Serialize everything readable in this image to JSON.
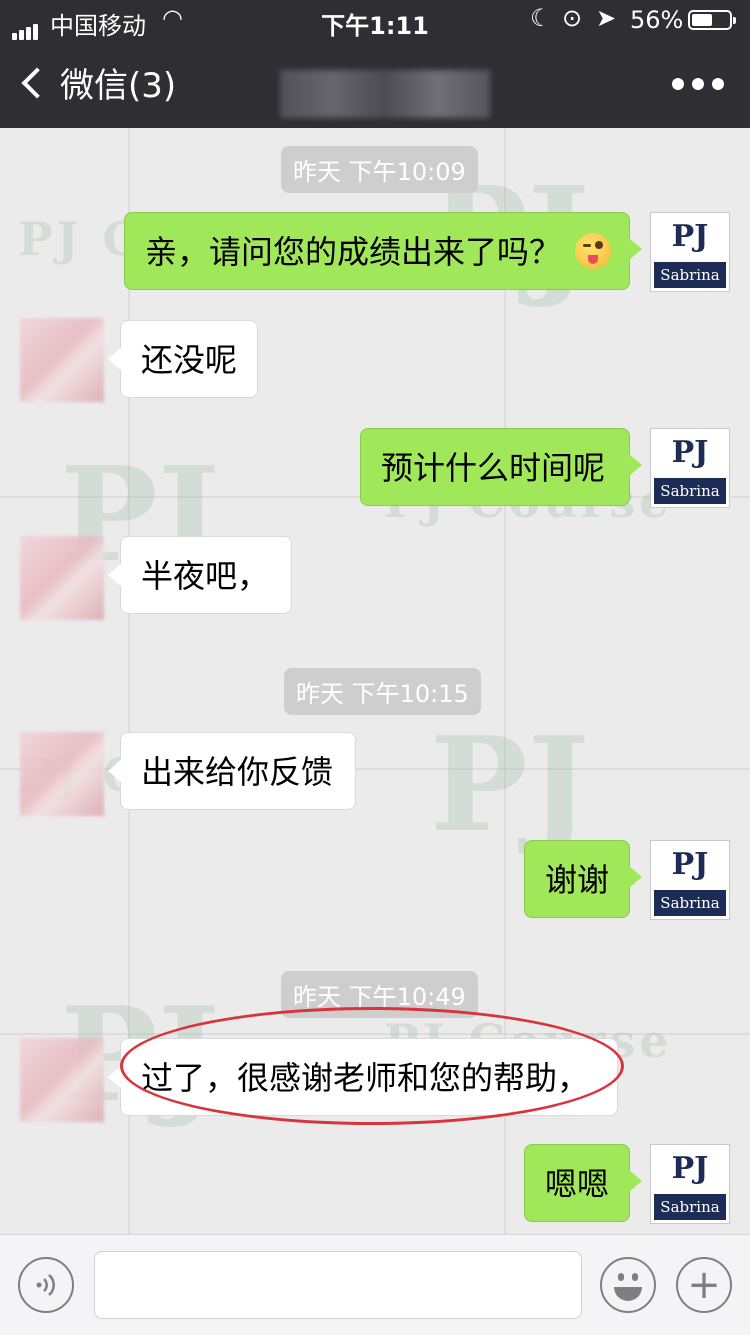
{
  "status_bar": {
    "carrier": "中国移动",
    "time": "下午1:11",
    "battery_percent": "56%",
    "battery_level": 0.56
  },
  "nav": {
    "back_label": "微信(3)"
  },
  "messages": [
    {
      "type": "time",
      "text": "昨天 下午10:09"
    },
    {
      "type": "out",
      "text": "亲，请问您的成绩出来了吗？",
      "emoji": "winking-tongue-emoji"
    },
    {
      "type": "in",
      "text": "还没呢"
    },
    {
      "type": "out",
      "text": "预计什么时间呢"
    },
    {
      "type": "in",
      "text": "半夜吧，"
    },
    {
      "type": "time",
      "text": "昨天 下午10:15"
    },
    {
      "type": "in",
      "text": "出来给你反馈"
    },
    {
      "type": "out",
      "text": "谢谢"
    },
    {
      "type": "time",
      "text": "昨天 下午10:49"
    },
    {
      "type": "in",
      "text": "过了，很感谢老师和您的帮助，"
    },
    {
      "type": "out",
      "text": "嗯嗯"
    }
  ],
  "avatar_out": {
    "line1": "PJ",
    "line2": "Sabrina"
  },
  "watermark": {
    "big": "PJ",
    "small": "PJ Course"
  },
  "input_bar": {
    "voice_icon": "voice-icon",
    "emoji_icon": "smiley-icon",
    "plus_icon": "plus-icon",
    "plus_glyph": "+"
  },
  "colors": {
    "nav_bg": "#2e2e33",
    "chat_bg": "#ebebeb",
    "out_bubble": "#a0e75a",
    "in_bubble": "#ffffff",
    "highlight_circle": "#d9343d"
  }
}
